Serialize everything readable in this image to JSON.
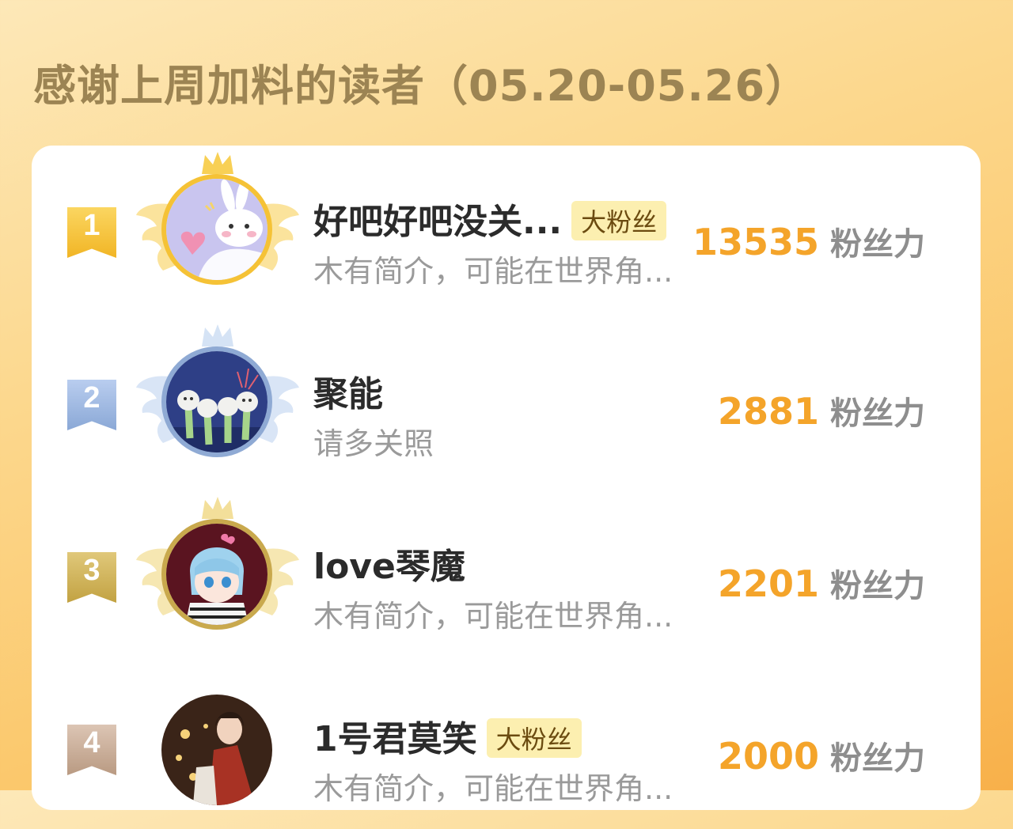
{
  "header": {
    "title": "感谢上周加料的读者（05.20-05.26）"
  },
  "colors": {
    "score": "#f4a42a",
    "gold": "#f5c236",
    "silver": "#9bb8e0",
    "bronze": "#cfae55",
    "fourth": "#c9ab96"
  },
  "unit_label": "粉丝力",
  "readers": [
    {
      "rank": "1",
      "name": "好吧好吧没关...",
      "badge": "大粉丝",
      "bio": "木有简介，可能在世界角...",
      "score": "13535"
    },
    {
      "rank": "2",
      "name": "聚能",
      "badge": "",
      "bio": "请多关照",
      "score": "2881"
    },
    {
      "rank": "3",
      "name": "love琴魔",
      "badge": "",
      "bio": "木有简介，可能在世界角...",
      "score": "2201"
    },
    {
      "rank": "4",
      "name": "1号君莫笑",
      "badge": "大粉丝",
      "bio": "木有简介，可能在世界角...",
      "score": "2000"
    }
  ]
}
